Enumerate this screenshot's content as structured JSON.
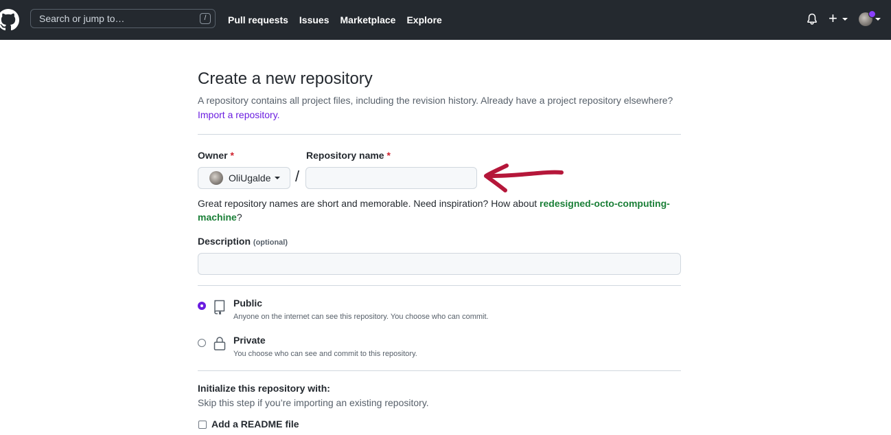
{
  "header": {
    "search_placeholder": "Search or jump to…",
    "search_shortcut": "/",
    "nav": [
      "Pull requests",
      "Issues",
      "Marketplace",
      "Explore"
    ],
    "plus_label": "+"
  },
  "page": {
    "title": "Create a new repository",
    "subtitle": "A repository contains all project files, including the revision history. Already have a project repository elsewhere?",
    "import_link": "Import a repository."
  },
  "form": {
    "owner_label": "Owner",
    "required_mark": "*",
    "owner_value": "OliUgalde",
    "separator": "/",
    "repo_name_label": "Repository name",
    "repo_name_value": "",
    "hint_prefix": "Great repository names are short and memorable. Need inspiration? How about ",
    "hint_suggestion": "redesigned-octo-computing-machine",
    "hint_suffix": "?",
    "description_label": "Description",
    "description_optional": "(optional)",
    "description_value": ""
  },
  "visibility": {
    "public_title": "Public",
    "public_desc": "Anyone on the internet can see this repository. You choose who can commit.",
    "public_checked": true,
    "private_title": "Private",
    "private_desc": "You choose who can see and commit to this repository.",
    "private_checked": false
  },
  "init": {
    "title": "Initialize this repository with:",
    "subtitle": "Skip this step if you’re importing an existing repository.",
    "readme_label": "Add a README file",
    "readme_checked": false
  },
  "colors": {
    "header_bg": "#24292f",
    "accent": "#6a1de0",
    "suggestion": "#1a7f37",
    "required": "#cf222e",
    "annotation_arrow": "#b5173a"
  },
  "icons": [
    "github-logo-icon",
    "bell-icon",
    "plus-icon",
    "repo-icon",
    "lock-icon"
  ]
}
